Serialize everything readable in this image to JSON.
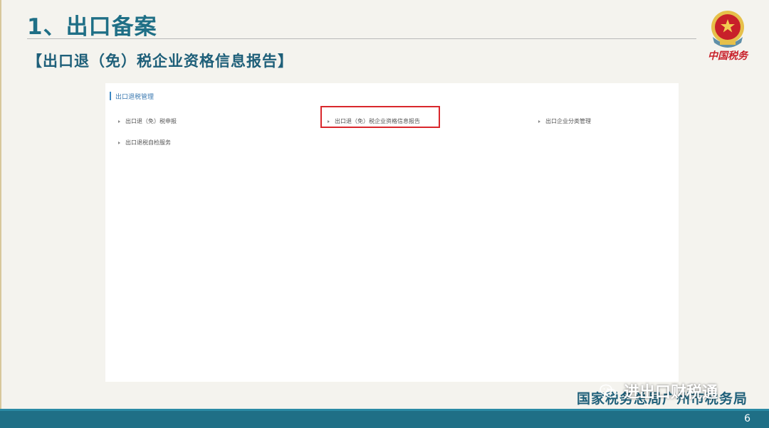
{
  "slide": {
    "title": "1、出口备案",
    "subtitle": "【出口退（免）税企业资格信息报告】",
    "emblem_text": "中国税务",
    "footer_org": "国家税务总局广州市税务局",
    "watermark": "进出口财税通",
    "page_number": "6"
  },
  "panel": {
    "section_title": "出口退税管理",
    "items": [
      {
        "label": "出口退（免）税申报"
      },
      {
        "label": "出口退（免）税企业资格信息报告"
      },
      {
        "label": "出口企业分类管理"
      },
      {
        "label": "出口退税自检服务"
      }
    ]
  },
  "colors": {
    "title": "#1f6f86",
    "footer_bar": "#1f6f86",
    "highlight_border": "#d9272c",
    "section_accent": "#3b88c4"
  },
  "icons": {
    "emblem": "national-tax-emblem-icon",
    "watermark": "wechat-icon",
    "menu_item": "triangle-right-icon"
  }
}
